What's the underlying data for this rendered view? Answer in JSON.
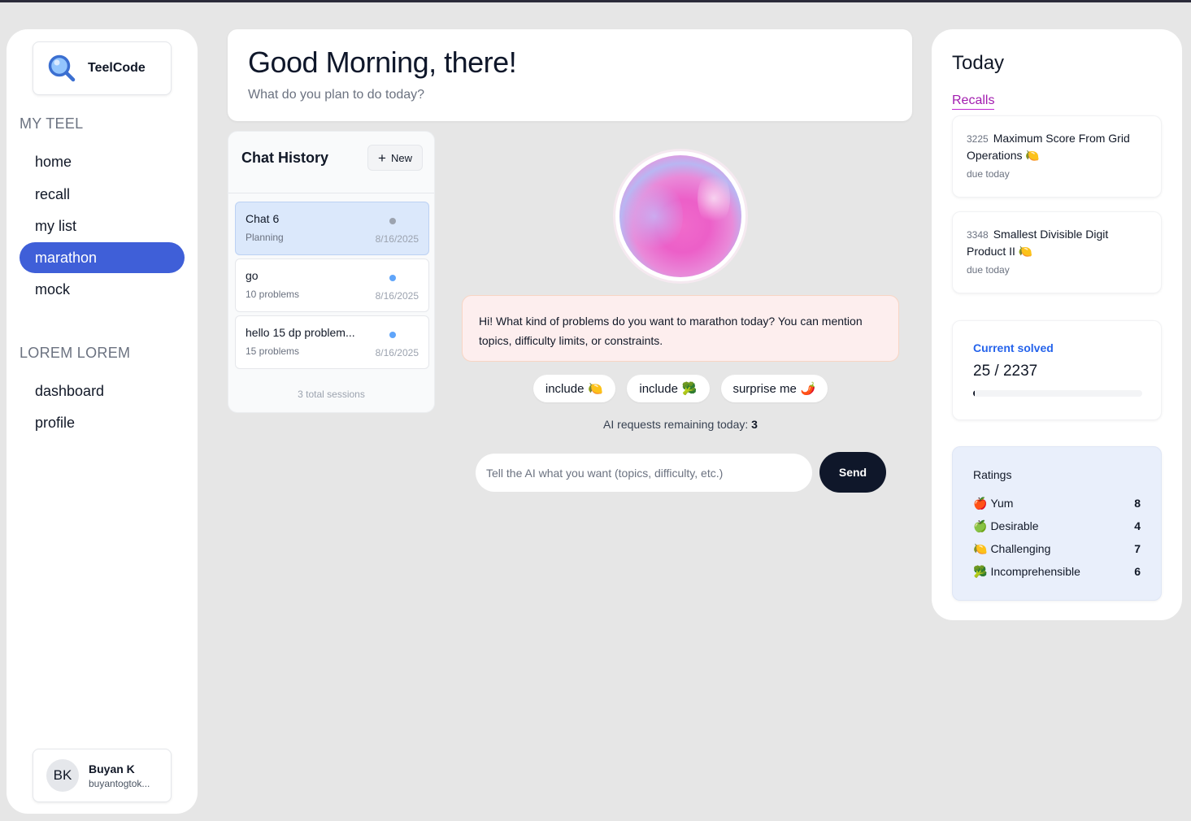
{
  "brand": {
    "name": "TeelCode"
  },
  "sidebar": {
    "section1": "MY TEEL",
    "nav1": [
      {
        "label": "home",
        "active": false
      },
      {
        "label": "recall",
        "active": false
      },
      {
        "label": "my list",
        "active": false
      },
      {
        "label": "marathon",
        "active": true
      },
      {
        "label": "mock",
        "active": false
      }
    ],
    "section2": "LOREM LOREM",
    "nav2": [
      {
        "label": "dashboard"
      },
      {
        "label": "profile"
      }
    ],
    "user": {
      "initials": "BK",
      "name": "Buyan K",
      "email": "buyantogtok..."
    }
  },
  "header": {
    "greeting": "Good Morning, there!",
    "subtitle": "What do you plan to do today?"
  },
  "chat_history": {
    "title": "Chat History",
    "new_label": "New",
    "items": [
      {
        "title": "Chat 6",
        "subtitle": "Planning",
        "date": "8/16/2025",
        "dot_color": "#9ca3af",
        "active": true
      },
      {
        "title": "go",
        "subtitle": "10 problems",
        "date": "8/16/2025",
        "dot_color": "#60a5fa",
        "active": false
      },
      {
        "title": "hello 15 dp problem...",
        "subtitle": "15 problems",
        "date": "8/16/2025",
        "dot_color": "#60a5fa",
        "active": false
      }
    ],
    "total": "3 total sessions"
  },
  "assistant": {
    "message": "Hi! What kind of problems do you want to marathon today? You can mention topics, difficulty limits, or constraints.",
    "chips": [
      {
        "label": "include",
        "emoji": "🍋"
      },
      {
        "label": "include",
        "emoji": "🥦"
      },
      {
        "label": "surprise me",
        "emoji": "🌶️"
      }
    ],
    "remaining_label": "AI requests remaining today:",
    "remaining_count": "3",
    "input_placeholder": "Tell the AI what you want (topics, difficulty, etc.)",
    "send_label": "Send"
  },
  "today": {
    "title": "Today",
    "recalls_label": "Recalls",
    "recalls": [
      {
        "number": "3225",
        "title": "Maximum Score From Grid Operations",
        "emoji": "🍋",
        "due": "due today"
      },
      {
        "number": "3348",
        "title": "Smallest Divisible Digit Product II",
        "emoji": "🍋",
        "due": "due today"
      }
    ],
    "current_solved": {
      "label": "Current solved",
      "value": "25 / 2237",
      "fraction": 0.0112
    },
    "ratings": {
      "title": "Ratings",
      "items": [
        {
          "emoji": "🍎",
          "label": "Yum",
          "count": "8"
        },
        {
          "emoji": "🍏",
          "label": "Desirable",
          "count": "4"
        },
        {
          "emoji": "🍋",
          "label": "Challenging",
          "count": "7"
        },
        {
          "emoji": "🥦",
          "label": "Incomprehensible",
          "count": "6"
        }
      ]
    }
  },
  "colors": {
    "accent": "#3f5fd8",
    "send": "#0f172a",
    "recalls": "#a21caf",
    "solved_label": "#2563eb"
  }
}
